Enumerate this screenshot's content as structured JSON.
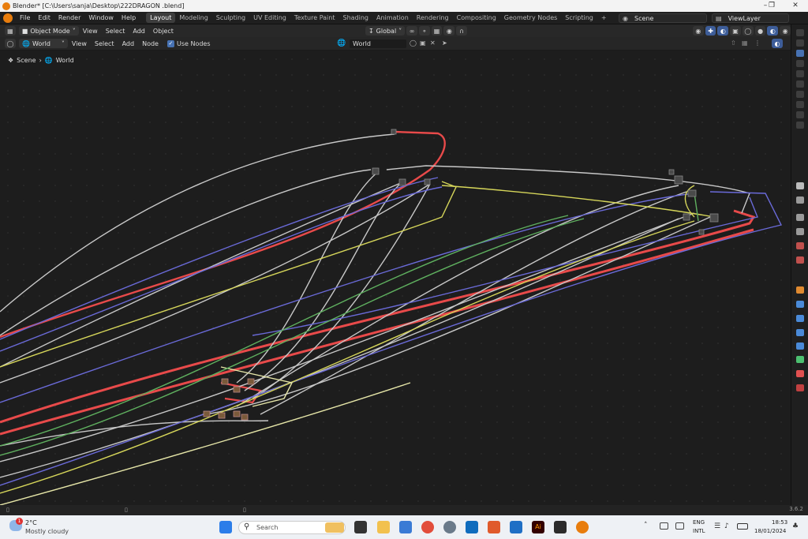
{
  "window": {
    "title": "Blender* [C:\\Users\\sanja\\Desktop\\222DRAGON .blend]",
    "minimize": "–",
    "maximize": "❐",
    "close": "✕"
  },
  "topbar": {
    "menus": [
      "File",
      "Edit",
      "Render",
      "Window",
      "Help"
    ],
    "workspaces": [
      "Layout",
      "Modeling",
      "Sculpting",
      "UV Editing",
      "Texture Paint",
      "Shading",
      "Animation",
      "Rendering",
      "Compositing",
      "Geometry Nodes",
      "Scripting"
    ],
    "active_workspace": "Layout",
    "add_workspace": "+",
    "scene": "Scene",
    "view_layer": "ViewLayer"
  },
  "editor_header": {
    "mode": "Object Mode",
    "menus": [
      "View",
      "Select",
      "Add",
      "Object"
    ],
    "transform_orientation": "Global"
  },
  "node_header": {
    "shader_type": "World",
    "menus": [
      "View",
      "Select",
      "Add",
      "Node"
    ],
    "use_nodes_label": "Use Nodes",
    "use_nodes_checked": true,
    "world_name": "World"
  },
  "breadcrumb": {
    "scene": "Scene",
    "world": "World"
  },
  "status": {
    "version": "3.6.2"
  },
  "taskbar": {
    "weather_temp": "2°C",
    "weather_desc": "Mostly cloudy",
    "weather_badge": "1",
    "search_placeholder": "Search",
    "lang_top": "ENG",
    "lang_bottom": "INTL",
    "time": "18:53",
    "date": "18/01/2024"
  },
  "colors": {
    "accent_blue": "#4772b3",
    "wire_red": "#e84a4a",
    "wire_white": "#c8c8c8",
    "wire_blue": "#6a6ad8",
    "wire_yellow": "#d6d65a",
    "wire_green": "#5fb05f",
    "blender_orange": "#e87d0d"
  }
}
